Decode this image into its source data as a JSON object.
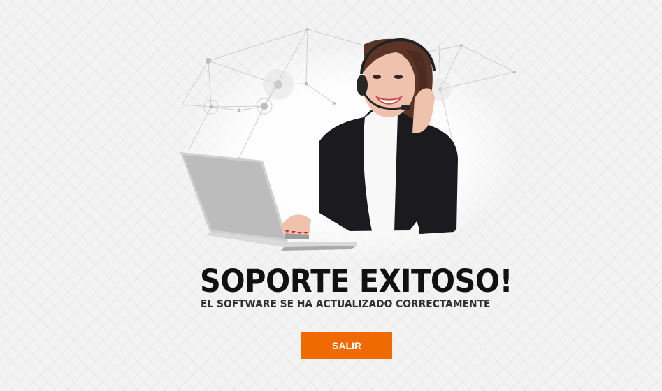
{
  "hero": {
    "image": "support-agent-with-headset-and-laptop"
  },
  "message": {
    "title": "SOPORTE EXITOSO!",
    "subtitle": "EL SOFTWARE SE HA ACTUALIZADO CORRECTAMENTE"
  },
  "actions": {
    "exit_label": "SALIR"
  },
  "colors": {
    "accent": "#ef6a00",
    "title": "#111111",
    "background": "#f3f3f3"
  }
}
